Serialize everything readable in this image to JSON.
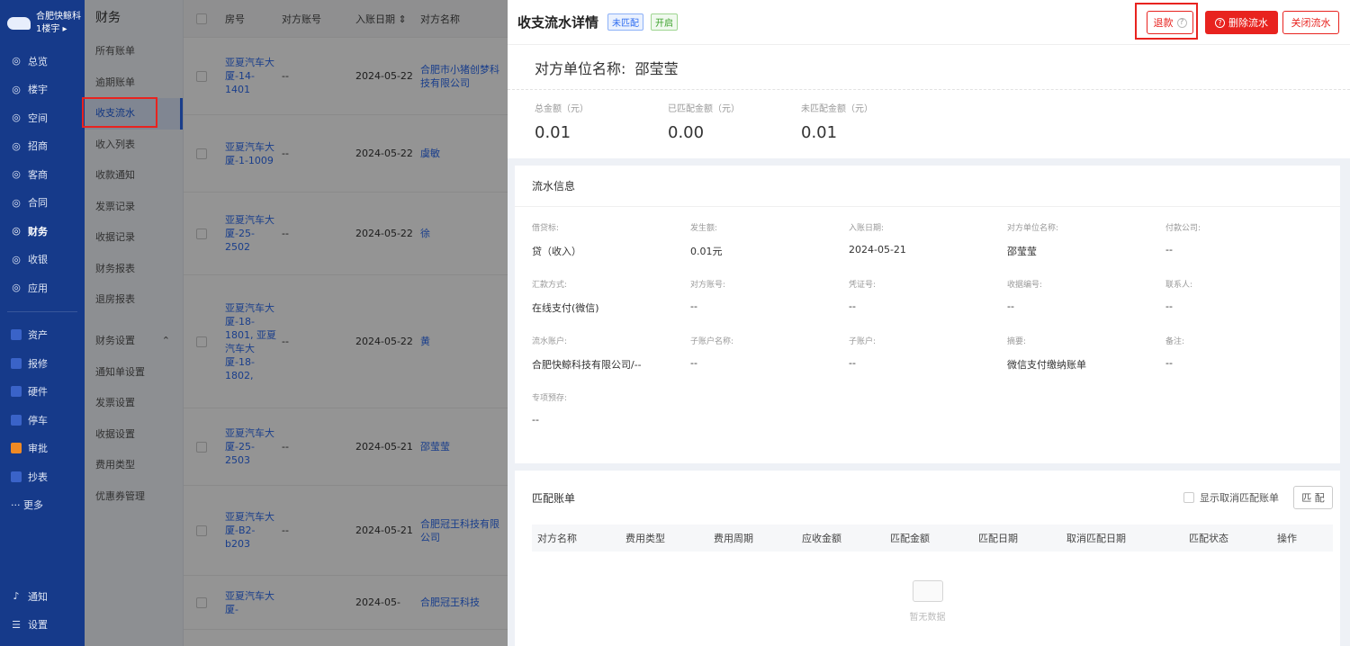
{
  "nav": {
    "brand_line1": "合肥快鲸科",
    "brand_line2": "1楼宇",
    "items": [
      {
        "icon": "总",
        "label": "总览"
      },
      {
        "icon": "楼",
        "label": "楼宇"
      },
      {
        "icon": "空",
        "label": "空间"
      },
      {
        "icon": "招",
        "label": "招商"
      },
      {
        "icon": "客",
        "label": "客商"
      },
      {
        "icon": "合",
        "label": "合同"
      },
      {
        "icon": "财",
        "label": "财务"
      },
      {
        "icon": "收",
        "label": "收银"
      },
      {
        "icon": "应",
        "label": "应用"
      }
    ],
    "apps": [
      "资产",
      "报修",
      "硬件",
      "停车",
      "审批",
      "抄表"
    ],
    "more": "··· 更多",
    "notify": "通知",
    "settings": "设置"
  },
  "submenu": {
    "title": "财务",
    "items": [
      "所有账单",
      "逾期账单",
      "收支流水",
      "收入列表",
      "收款通知",
      "发票记录",
      "收据记录",
      "财务报表",
      "退房报表"
    ],
    "group": "财务设置",
    "group_items": [
      "通知单设置",
      "发票设置",
      "收据设置",
      "费用类型",
      "优惠券管理"
    ]
  },
  "table": {
    "headers": [
      "房号",
      "对方账号",
      "入账日期",
      "对方名称"
    ],
    "rows": [
      {
        "room": "亚夏汽车大厦-14-1401",
        "acct": "--",
        "date": "2024-05-22",
        "name": "合肥市小猪创梦科技有限公司"
      },
      {
        "room": "亚夏汽车大厦-1-1009",
        "acct": "--",
        "date": "2024-05-22",
        "name": "虞敏"
      },
      {
        "room": "亚夏汽车大厦-25-2502",
        "acct": "--",
        "date": "2024-05-22",
        "name": "徐"
      },
      {
        "room": "亚夏汽车大厦-18-1801, 亚夏汽车大厦-18-1802,",
        "acct": "--",
        "date": "2024-05-22",
        "name": "黄"
      },
      {
        "room": "亚夏汽车大厦-25-2503",
        "acct": "--",
        "date": "2024-05-21",
        "name": "邵莹莹"
      },
      {
        "room": "亚夏汽车大厦-B2-b203",
        "acct": "--",
        "date": "2024-05-21",
        "name": "合肥冠王科技有限公司"
      },
      {
        "room": "亚夏汽车大厦-",
        "acct": "",
        "date": "2024-05-",
        "name": "合肥冠王科技"
      }
    ]
  },
  "drawer": {
    "title": "收支流水详情",
    "tag_unmatched": "未匹配",
    "tag_enabled": "开启",
    "refund": "退款",
    "delete": "删除流水",
    "close": "关闭流水",
    "party_label": "对方单位名称:",
    "party_name": "邵莹莹",
    "sums": [
      {
        "label": "总金额（元）",
        "value": "0.01"
      },
      {
        "label": "已匹配金额（元）",
        "value": "0.00"
      },
      {
        "label": "未匹配金额（元）",
        "value": "0.01"
      }
    ],
    "flow_title": "流水信息",
    "fields": [
      {
        "k": "借贷标:",
        "v": "贷（收入）"
      },
      {
        "k": "发生额:",
        "v": "0.01元"
      },
      {
        "k": "入账日期:",
        "v": "2024-05-21"
      },
      {
        "k": "对方单位名称:",
        "v": "邵莹莹"
      },
      {
        "k": "付款公司:",
        "v": "--"
      },
      {
        "k": "汇款方式:",
        "v": "在线支付(微信)"
      },
      {
        "k": "对方账号:",
        "v": "--"
      },
      {
        "k": "凭证号:",
        "v": "--"
      },
      {
        "k": "收据编号:",
        "v": "--"
      },
      {
        "k": "联系人:",
        "v": "--"
      },
      {
        "k": "流水账户:",
        "v": "合肥快鲸科技有限公司/--"
      },
      {
        "k": "子账户名称:",
        "v": "--"
      },
      {
        "k": "子账户:",
        "v": "--"
      },
      {
        "k": "摘要:",
        "v": "微信支付缴纳账单"
      },
      {
        "k": "备注:",
        "v": "--"
      },
      {
        "k": "专项预存:",
        "v": "--"
      }
    ],
    "match_title": "匹配账单",
    "show_cancelled": "显示取消匹配账单",
    "match_btn": "匹 配",
    "match_cols": [
      "对方名称",
      "费用类型",
      "费用周期",
      "应收金额",
      "匹配金额",
      "匹配日期",
      "取消匹配日期",
      "匹配状态",
      "操作"
    ],
    "empty": "暂无数据"
  }
}
